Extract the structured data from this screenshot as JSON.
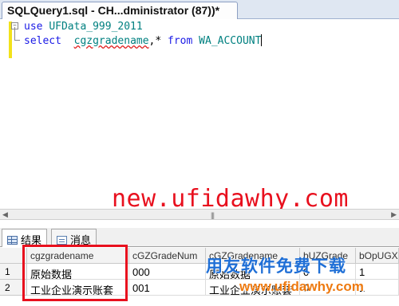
{
  "tab": {
    "title": "SQLQuery1.sql - CH...dministrator (87))*"
  },
  "editor": {
    "line1": {
      "keyword": "use",
      "identifier": "UFData_999_2011"
    },
    "line2": {
      "keyword_select": "select",
      "column": "cgzgradename",
      "rest": ",* ",
      "keyword_from": "from",
      "table": "WA_ACCOUNT"
    }
  },
  "watermark_top": "new.ufidawhy.com",
  "result_tabs": [
    {
      "label": "结果",
      "icon": "grid-icon"
    },
    {
      "label": "消息",
      "icon": "message-icon"
    }
  ],
  "grid": {
    "columns": [
      "cgzgradename",
      "cGZGradeNum",
      "cGZGradename",
      "bUZGrade",
      "bOpUGX"
    ],
    "rows": [
      {
        "num": "1",
        "cells": [
          "原始数据",
          "000",
          "原始数据",
          "0",
          "1"
        ]
      },
      {
        "num": "2",
        "cells": [
          "工业企业演示账套",
          "001",
          "工业企业演示账套",
          "0",
          "1"
        ]
      }
    ]
  },
  "watermark_bottom": {
    "cn": "用友软件免费下载",
    "url": "www.ufidawhy.com"
  },
  "colors": {
    "highlight": "#e8101e",
    "keyword": "#1a1ae6",
    "identifier": "#008080"
  }
}
